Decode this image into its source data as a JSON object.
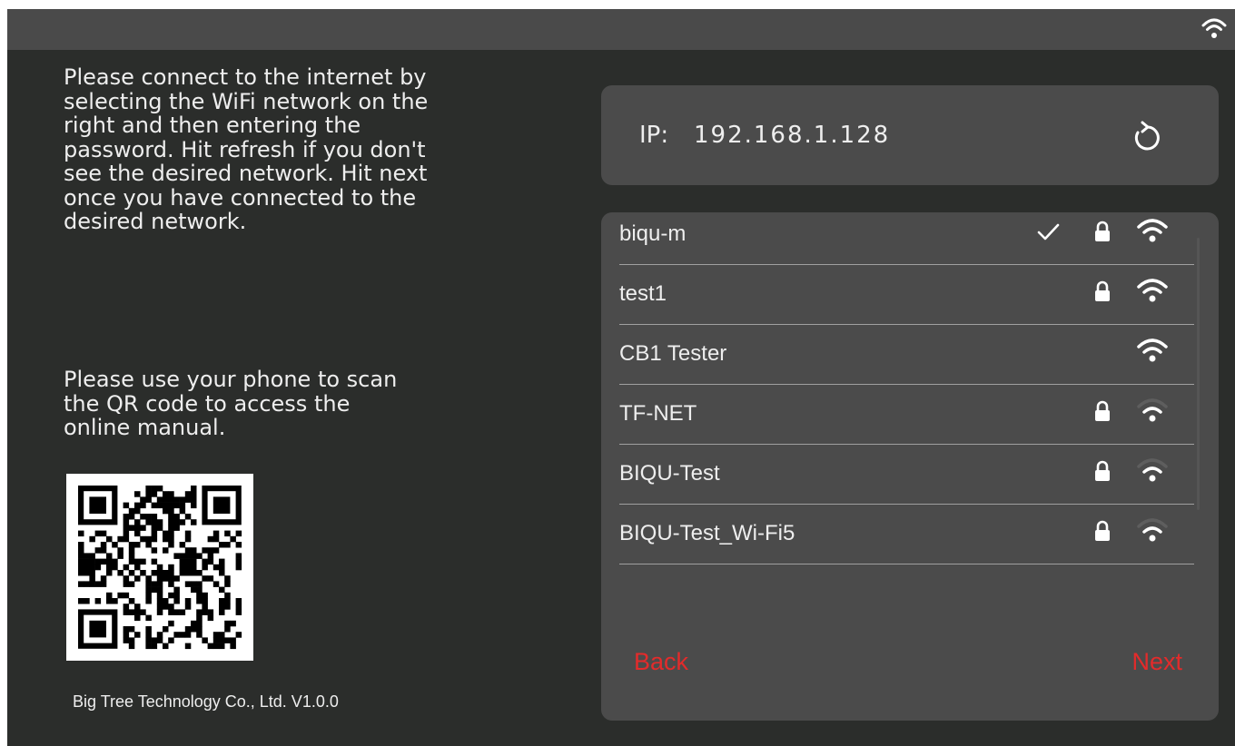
{
  "status_bar": {
    "wifi_icon": "wifi-icon"
  },
  "instructions": {
    "connect_text": "Please connect to the internet by\nselecting the WiFi network on the\nright and then entering the\npassword. Hit refresh if you don't\nsee the desired network. Hit next\nonce you have connected to the\ndesired network.",
    "qr_text": "Please use your phone to scan\nthe QR code to access the\nonline manual."
  },
  "qr_code": {
    "icon": "qr-code"
  },
  "footer": {
    "text": "Big Tree Technology Co., Ltd. V1.0.0"
  },
  "ip_panel": {
    "label": "IP:",
    "value": "192.168.1.128",
    "refresh_icon": "refresh-icon"
  },
  "networks": [
    {
      "name": "biqu-m",
      "connected": true,
      "locked": true,
      "signal": "strong"
    },
    {
      "name": "test1",
      "connected": false,
      "locked": true,
      "signal": "strong"
    },
    {
      "name": "CB1 Tester",
      "connected": false,
      "locked": false,
      "signal": "strong"
    },
    {
      "name": "TF-NET",
      "connected": false,
      "locked": true,
      "signal": "medium"
    },
    {
      "name": "BIQU-Test",
      "connected": false,
      "locked": true,
      "signal": "medium"
    },
    {
      "name": "BIQU-Test_Wi-Fi5",
      "connected": false,
      "locked": true,
      "signal": "medium"
    }
  ],
  "buttons": {
    "back": "Back",
    "next": "Next"
  },
  "colors": {
    "background": "#2b2d2b",
    "panel": "#4b4b4b",
    "status_bar": "#4a4a4a",
    "text": "#eeeeee",
    "action": "#e32b2b"
  }
}
